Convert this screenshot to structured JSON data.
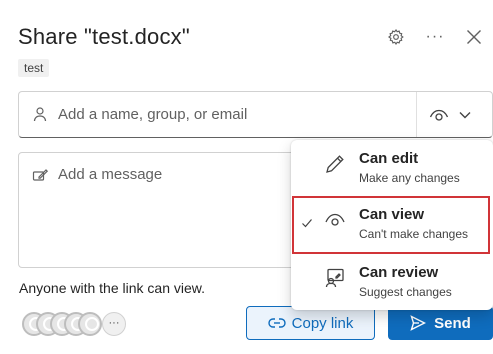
{
  "dialog": {
    "title": "Share \"test.docx\"",
    "tag": "test"
  },
  "header_icons": {
    "settings": "gear-icon",
    "more": "···",
    "close": "close-icon"
  },
  "people_input": {
    "placeholder": "Add a name, group, or email",
    "icon": "person-icon",
    "permission_icon": "eye-icon"
  },
  "message_input": {
    "placeholder": "Add a message",
    "icon": "edit-message-icon"
  },
  "info_text": "Anyone with the link can view.",
  "avatars": {
    "count": 5,
    "more_label": "···"
  },
  "buttons": {
    "copy_link": "Copy link",
    "send": "Send"
  },
  "permission_menu": {
    "selected": "Can view",
    "items": [
      {
        "title": "Can edit",
        "subtitle": "Make any changes",
        "icon": "pencil-icon"
      },
      {
        "title": "Can view",
        "subtitle": "Can't make changes",
        "icon": "eye-icon"
      },
      {
        "title": "Can review",
        "subtitle": "Suggest changes",
        "icon": "review-icon"
      }
    ]
  },
  "colors": {
    "accent": "#0f6cbd",
    "highlight": "#d13438"
  }
}
